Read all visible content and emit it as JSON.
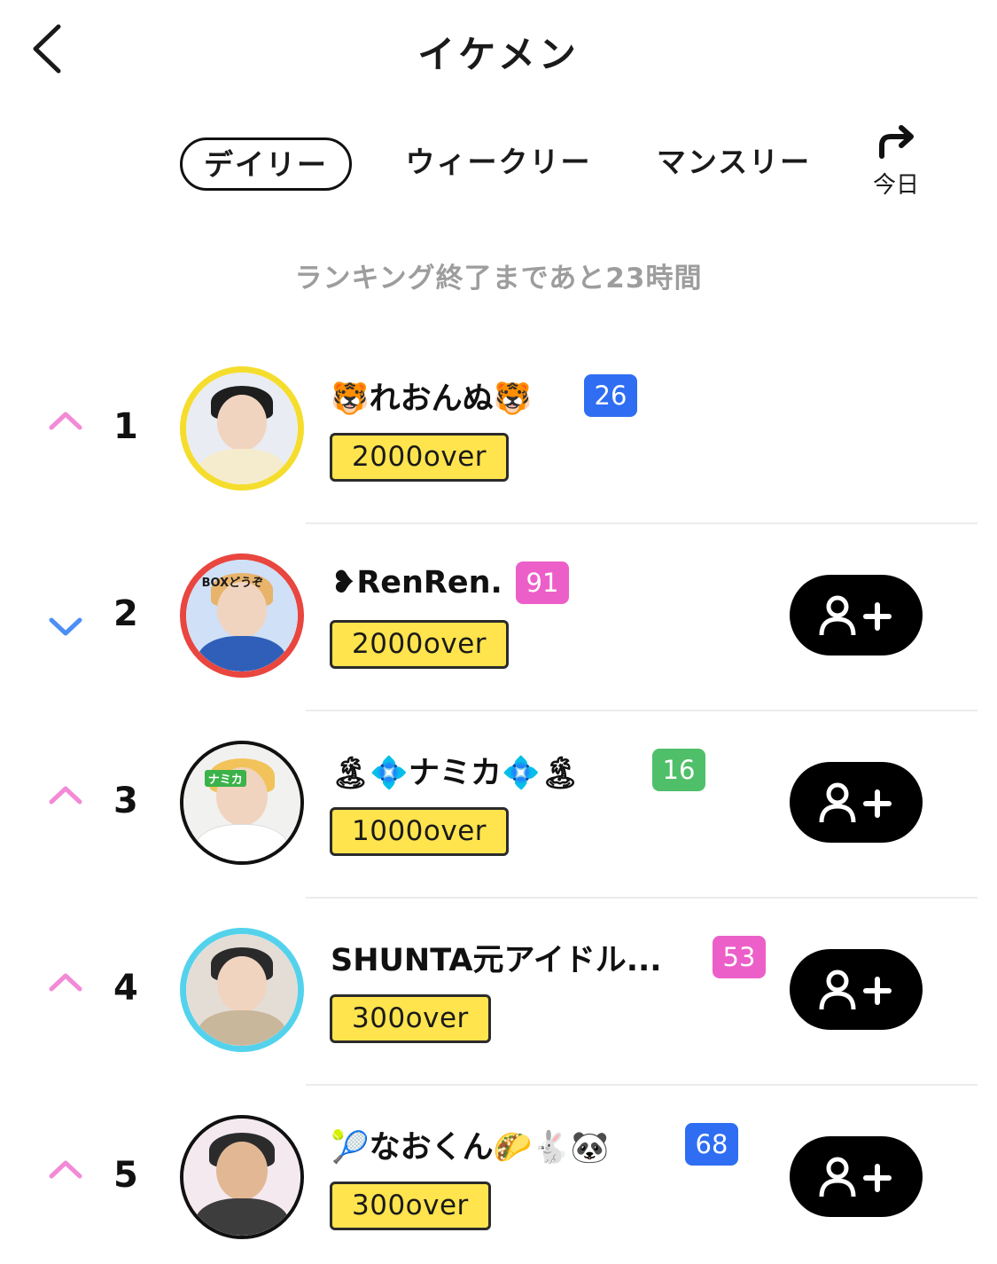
{
  "header": {
    "title": "イケメン"
  },
  "tabs": [
    {
      "label": "デイリー",
      "active": true
    },
    {
      "label": "ウィークリー",
      "active": false
    },
    {
      "label": "マンスリー",
      "active": false
    }
  ],
  "today_button": {
    "label": "今日"
  },
  "countdown": "ランキング終了まであと23時間",
  "rankings": [
    {
      "rank": "1",
      "trend": "up",
      "name": "🐯れおんぬ🐯",
      "level": "26",
      "level_color": "#2f6ef3",
      "over": "2000over",
      "ring_color": "#f5dd2e",
      "follow_visible": false
    },
    {
      "rank": "2",
      "trend": "down",
      "name": "❥RenRen.",
      "level": "91",
      "level_color": "#ec5fc9",
      "over": "2000over",
      "ring_color": "#e8463f",
      "follow_visible": true
    },
    {
      "rank": "3",
      "trend": "up",
      "name": "🏝💠ナミカ💠🏝",
      "level": "16",
      "level_color": "#4fbf6a",
      "over": "1000over",
      "ring_color": "#111111",
      "follow_visible": true
    },
    {
      "rank": "4",
      "trend": "up",
      "name": "SHUNTA元アイドル...",
      "level": "53",
      "level_color": "#ec5fc9",
      "over": "300over",
      "ring_color": "#54d2ec",
      "follow_visible": true
    },
    {
      "rank": "5",
      "trend": "up",
      "name": "🎾なおくん🌮🐇🐼",
      "level": "68",
      "level_color": "#2f6ef3",
      "over": "300over",
      "ring_color": "#111111",
      "follow_visible": true
    }
  ],
  "avatar_captions": [
    "BOXどうぞ",
    "ナミカ"
  ],
  "colors": {
    "trend_up": "#f28ad6",
    "trend_down": "#4c8ff5",
    "over_badge_bg": "#ffe44d",
    "countdown_text": "#9d9d9d"
  }
}
